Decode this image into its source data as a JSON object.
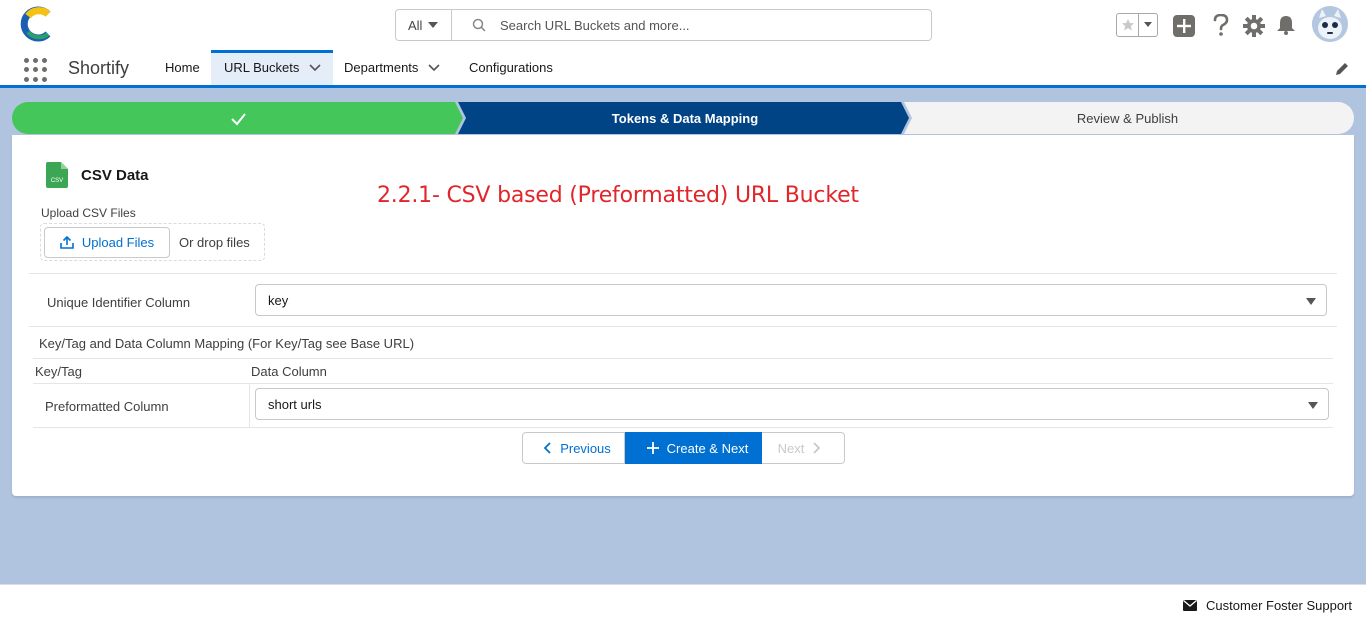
{
  "header": {
    "search_scope": "All",
    "search_placeholder": "Search URL Buckets and more..."
  },
  "nav": {
    "app_name": "Shortify",
    "items": [
      {
        "label": "Home"
      },
      {
        "label": "URL Buckets"
      },
      {
        "label": "Departments"
      },
      {
        "label": "Configurations"
      }
    ]
  },
  "path": {
    "steps": [
      {
        "label": "",
        "status": "complete"
      },
      {
        "label": "Tokens & Data Mapping",
        "status": "current"
      },
      {
        "label": "Review & Publish",
        "status": "incomplete"
      }
    ]
  },
  "card": {
    "title": "CSV Data",
    "icon_label": "CSV",
    "annotation": "2.2.1- CSV based (Preformatted) URL Bucket",
    "upload_label": "Upload CSV Files",
    "upload_button": "Upload Files",
    "drop_text": "Or drop files",
    "unique_identifier_label": "Unique Identifier Column",
    "unique_identifier_value": "key",
    "mapping_heading": "Key/Tag and Data Column Mapping (For Key/Tag see Base URL)",
    "col_key_tag": "Key/Tag",
    "col_data_column": "Data Column",
    "rows": [
      {
        "key": "Preformatted Column",
        "value": "short urls"
      }
    ],
    "btn_previous": "Previous",
    "btn_create_next": "Create & Next",
    "btn_next": "Next"
  },
  "footer": {
    "support": "Customer Foster Support"
  },
  "colors": {
    "brand_blue": "#0070d2",
    "path_complete": "#45c65a",
    "path_current": "#014486",
    "annotation_red": "#e0262b"
  }
}
